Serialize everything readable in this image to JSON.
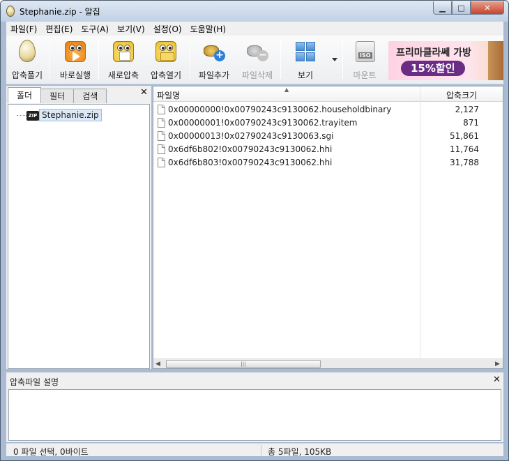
{
  "window": {
    "title": "Stephanie.zip - 알집"
  },
  "menu": [
    "파일(F)",
    "편집(E)",
    "도구(A)",
    "보기(V)",
    "설정(O)",
    "도움말(H)"
  ],
  "toolbar": {
    "open_archive": "압축풀기",
    "run_now": "바로실행",
    "new_archive": "새로압축",
    "open_file": "압축열기",
    "add_file": "파일추가",
    "delete_file": "파일삭제",
    "view": "보기",
    "mount": "마운트"
  },
  "ad": {
    "line1": "프리마클라쎄 가방",
    "line2": "15%할인"
  },
  "left_panel": {
    "tabs": [
      "폴더",
      "필터",
      "검색"
    ],
    "tree_item": "Stephanie.zip"
  },
  "file_list": {
    "col_name": "파일명",
    "col_size": "압축크기",
    "rows": [
      {
        "name": "0x00000000!0x00790243c9130062.householdbinary",
        "size": "2,127"
      },
      {
        "name": "0x00000001!0x00790243c9130062.trayitem",
        "size": "871"
      },
      {
        "name": "0x00000013!0x02790243c9130063.sgi",
        "size": "51,861"
      },
      {
        "name": "0x6df6b802!0x00790243c9130062.hhi",
        "size": "11,764"
      },
      {
        "name": "0x6df6b803!0x00790243c9130062.hhi",
        "size": "31,788"
      }
    ]
  },
  "description": {
    "title": "압축파일 설명"
  },
  "status": {
    "left": "0 파일 선택,  0바이트",
    "right": "총 5파일,  105KB"
  },
  "icons": {
    "close": "✕",
    "minimize": "▁",
    "maximize": "□"
  }
}
